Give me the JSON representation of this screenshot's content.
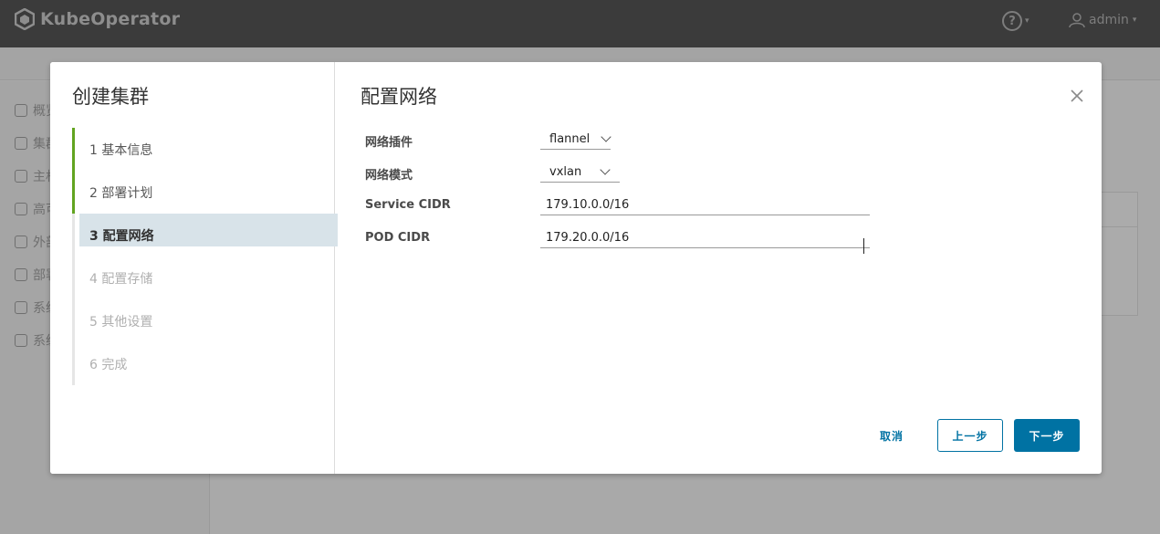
{
  "app": {
    "brand": "KubeOperator",
    "user": "admin"
  },
  "sidebar": {
    "items": [
      {
        "label": "概览"
      },
      {
        "label": "集群"
      },
      {
        "label": "主机"
      },
      {
        "label": "高可用"
      },
      {
        "label": "外部"
      },
      {
        "label": "部署"
      },
      {
        "label": "系统"
      },
      {
        "label": "系统设置"
      }
    ]
  },
  "wizard": {
    "title": "创建集群",
    "steps": [
      {
        "label": "1  基本信息",
        "state": "done"
      },
      {
        "label": "2  部署计划",
        "state": "done"
      },
      {
        "label": "3  配置网络",
        "state": "current"
      },
      {
        "label": "4  配置存储",
        "state": "pending"
      },
      {
        "label": "5  其他设置",
        "state": "pending"
      },
      {
        "label": "6  完成",
        "state": "pending"
      }
    ]
  },
  "form": {
    "page_title": "配置网络",
    "network_plugin": {
      "label": "网络插件",
      "value": "flannel"
    },
    "network_mode": {
      "label": "网络模式",
      "value": "vxlan"
    },
    "service_cidr": {
      "label": "Service CIDR",
      "value": "179.10.0.0/16"
    },
    "pod_cidr": {
      "label": "POD CIDR",
      "value": "179.20.0.0/16"
    }
  },
  "buttons": {
    "cancel": "取消",
    "prev": "上一步",
    "next": "下一步"
  },
  "colors": {
    "accent": "#0072a3",
    "done": "#62a420",
    "current_bg": "#d8e3e9"
  }
}
